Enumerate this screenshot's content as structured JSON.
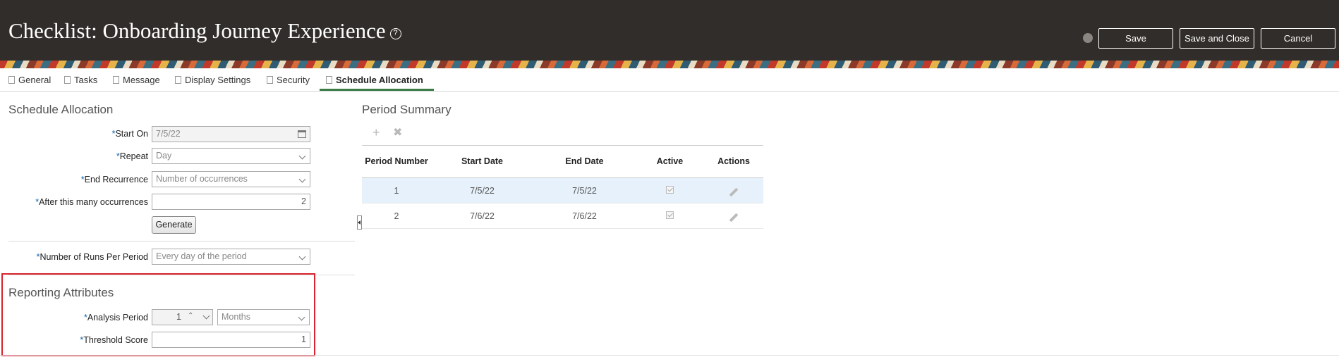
{
  "header": {
    "title": "Checklist: Onboarding Journey Experience",
    "help_icon": "?",
    "save": "Save",
    "save_close": "Save and Close",
    "cancel": "Cancel"
  },
  "tabs": [
    {
      "label": "General"
    },
    {
      "label": "Tasks"
    },
    {
      "label": "Message"
    },
    {
      "label": "Display Settings"
    },
    {
      "label": "Security"
    },
    {
      "label": "Schedule Allocation"
    }
  ],
  "schedule": {
    "title": "Schedule Allocation",
    "start_on_label": "Start On",
    "start_on": "7/5/22",
    "repeat_label": "Repeat",
    "repeat": "Day",
    "end_rec_label": "End Recurrence",
    "end_rec": "Number of occurrences",
    "after_label": "After this many occurrences",
    "after": "2",
    "generate": "Generate",
    "runs_label": "Number of Runs Per Period",
    "runs": "Every day of the period"
  },
  "reporting": {
    "title": "Reporting Attributes",
    "analysis_label": "Analysis Period",
    "analysis_value": "1",
    "analysis_unit": "Months",
    "threshold_label": "Threshold Score",
    "threshold": "1"
  },
  "period": {
    "title": "Period Summary",
    "columns": {
      "period_number": "Period Number",
      "start": "Start Date",
      "end": "End Date",
      "active": "Active",
      "actions": "Actions"
    },
    "rows": [
      {
        "num": "1",
        "start": "7/5/22",
        "end": "7/5/22"
      },
      {
        "num": "2",
        "start": "7/6/22",
        "end": "7/6/22"
      }
    ]
  },
  "required_mark": "*",
  "colors": {
    "header_bg": "#312d2a",
    "tab_accent": "#3a7d44",
    "highlight": "#d9232e"
  }
}
